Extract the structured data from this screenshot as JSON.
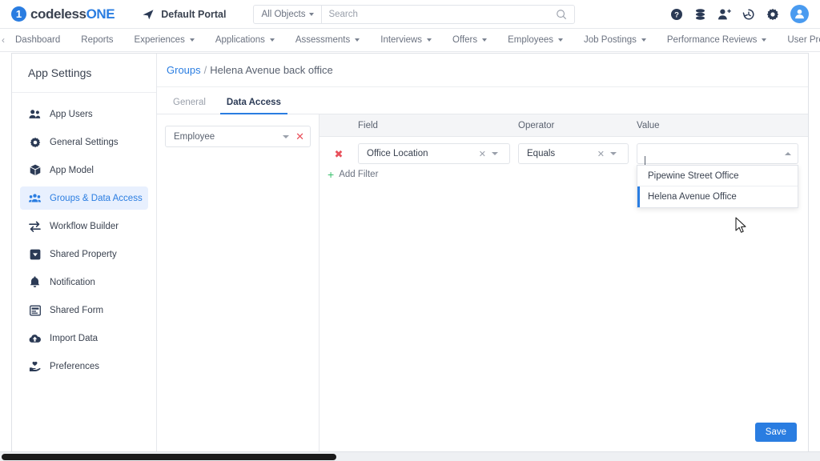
{
  "header": {
    "logo": {
      "mark": "1",
      "text_dark": "codeless",
      "text_blue": "ONE"
    },
    "portal": {
      "label": "Default Portal",
      "icon": "send-icon"
    },
    "search": {
      "scope": "All Objects",
      "placeholder": "Search",
      "value": ""
    },
    "icons": [
      {
        "name": "help-icon",
        "title": "Help"
      },
      {
        "name": "database-icon",
        "title": "Data"
      },
      {
        "name": "add-user-icon",
        "title": "Add User"
      },
      {
        "name": "history-icon",
        "title": "History"
      },
      {
        "name": "gear-icon",
        "title": "Settings"
      },
      {
        "name": "avatar",
        "title": "Account"
      }
    ]
  },
  "nav": {
    "prev_arrow": "‹",
    "next_arrow": "›",
    "items": [
      {
        "label": "Dashboard",
        "has_caret": false
      },
      {
        "label": "Reports",
        "has_caret": false
      },
      {
        "label": "Experiences",
        "has_caret": true
      },
      {
        "label": "Applications",
        "has_caret": true
      },
      {
        "label": "Assessments",
        "has_caret": true
      },
      {
        "label": "Interviews",
        "has_caret": true
      },
      {
        "label": "Offers",
        "has_caret": true
      },
      {
        "label": "Employees",
        "has_caret": true
      },
      {
        "label": "Job Postings",
        "has_caret": true
      },
      {
        "label": "Performance Reviews",
        "has_caret": true
      },
      {
        "label": "User Profile",
        "has_caret": true
      }
    ]
  },
  "sidebar": {
    "title": "App Settings",
    "items": [
      {
        "label": "App Users",
        "icon": "users-icon",
        "active": false
      },
      {
        "label": "General Settings",
        "icon": "gear-icon",
        "active": false
      },
      {
        "label": "App Model",
        "icon": "cube-icon",
        "active": false
      },
      {
        "label": "Groups & Data Access",
        "icon": "group-users-icon",
        "active": true
      },
      {
        "label": "Workflow Builder",
        "icon": "arrows-exchange-icon",
        "active": false
      },
      {
        "label": "Shared Property",
        "icon": "square-caret-icon",
        "active": false
      },
      {
        "label": "Notification",
        "icon": "bell-icon",
        "active": false
      },
      {
        "label": "Shared Form",
        "icon": "form-icon",
        "active": false
      },
      {
        "label": "Import Data",
        "icon": "cloud-upload-icon",
        "active": false
      },
      {
        "label": "Preferences",
        "icon": "hand-heart-icon",
        "active": false
      }
    ]
  },
  "breadcrumb": {
    "root": "Groups",
    "separator": "/",
    "current": "Helena Avenue back office"
  },
  "tabs": [
    {
      "label": "General",
      "active": false
    },
    {
      "label": "Data Access",
      "active": true
    }
  ],
  "object_selector": {
    "value": "Employee",
    "clear_icon": "✕"
  },
  "filter_table": {
    "columns": [
      "Field",
      "Operator",
      "Value"
    ],
    "rows": [
      {
        "remove_icon": "✖",
        "field": "Office Location",
        "operator": "Equals",
        "value": "",
        "value_caret": "caret-up-icon"
      }
    ],
    "add_filter": {
      "plus": "+",
      "label": "Add Filter"
    }
  },
  "dropdown": {
    "open": true,
    "options": [
      {
        "label": "Pipewine Street Office",
        "selected": false
      },
      {
        "label": "Helena Avenue Office",
        "selected": true
      }
    ]
  },
  "footer": {
    "save_label": "Save"
  },
  "colors": {
    "accent": "#2a7de1",
    "danger": "#e8505b",
    "success": "#3ac06d",
    "active_bg": "#e8f0fe",
    "text": "#3a4250",
    "muted": "#9aa0ab"
  }
}
